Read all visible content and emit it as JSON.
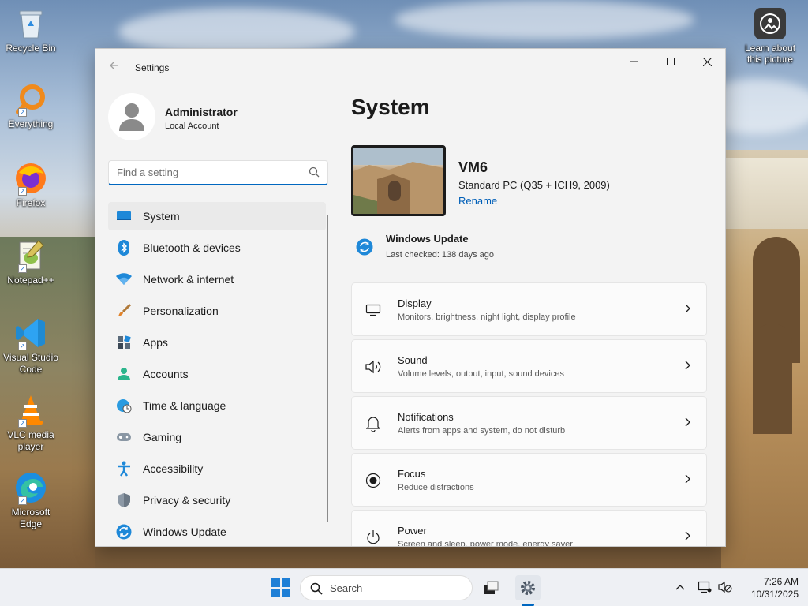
{
  "desktop": {
    "icons": [
      {
        "label": "Recycle Bin",
        "icon": "recycle-bin-icon"
      },
      {
        "label": "Everything",
        "icon": "everything-search-icon"
      },
      {
        "label": "Firefox",
        "icon": "firefox-icon"
      },
      {
        "label": "Notepad++",
        "icon": "notepadpp-icon"
      },
      {
        "label": "Visual Studio Code",
        "icon": "vscode-icon"
      },
      {
        "label": "VLC media player",
        "icon": "vlc-icon"
      },
      {
        "label": "Microsoft Edge",
        "icon": "edge-icon"
      }
    ],
    "learn_more": "Learn about this picture"
  },
  "window": {
    "title": "Settings",
    "controls": {
      "minimize": "–",
      "maximize": "☐",
      "close": "✕"
    }
  },
  "profile": {
    "name": "Administrator",
    "account_type": "Local Account"
  },
  "search": {
    "placeholder": "Find a setting",
    "value": ""
  },
  "nav": {
    "items": [
      {
        "label": "System",
        "icon": "system-icon",
        "active": true
      },
      {
        "label": "Bluetooth & devices",
        "icon": "bluetooth-icon"
      },
      {
        "label": "Network & internet",
        "icon": "wifi-icon"
      },
      {
        "label": "Personalization",
        "icon": "brush-icon"
      },
      {
        "label": "Apps",
        "icon": "apps-icon"
      },
      {
        "label": "Accounts",
        "icon": "accounts-icon"
      },
      {
        "label": "Time & language",
        "icon": "globe-clock-icon"
      },
      {
        "label": "Gaming",
        "icon": "gamepad-icon"
      },
      {
        "label": "Accessibility",
        "icon": "accessibility-icon"
      },
      {
        "label": "Privacy & security",
        "icon": "shield-icon"
      },
      {
        "label": "Windows Update",
        "icon": "update-icon"
      }
    ]
  },
  "main": {
    "title": "System",
    "device": {
      "name": "VM6",
      "model": "Standard PC (Q35 + ICH9, 2009)",
      "rename": "Rename"
    },
    "windows_update": {
      "title": "Windows Update",
      "subtitle": "Last checked: 138 days ago"
    },
    "cards": [
      {
        "title": "Display",
        "subtitle": "Monitors, brightness, night light, display profile",
        "icon": "monitor-icon"
      },
      {
        "title": "Sound",
        "subtitle": "Volume levels, output, input, sound devices",
        "icon": "speaker-icon"
      },
      {
        "title": "Notifications",
        "subtitle": "Alerts from apps and system, do not disturb",
        "icon": "bell-icon"
      },
      {
        "title": "Focus",
        "subtitle": "Reduce distractions",
        "icon": "focus-icon"
      },
      {
        "title": "Power",
        "subtitle": "Screen and sleep, power mode, energy saver",
        "icon": "power-icon"
      }
    ]
  },
  "taskbar": {
    "search_label": "Search",
    "time": "7:26 AM",
    "date": "10/31/2025"
  },
  "colors": {
    "accent": "#0067c0",
    "link": "#005fb8",
    "window_bg": "#f3f3f3"
  }
}
